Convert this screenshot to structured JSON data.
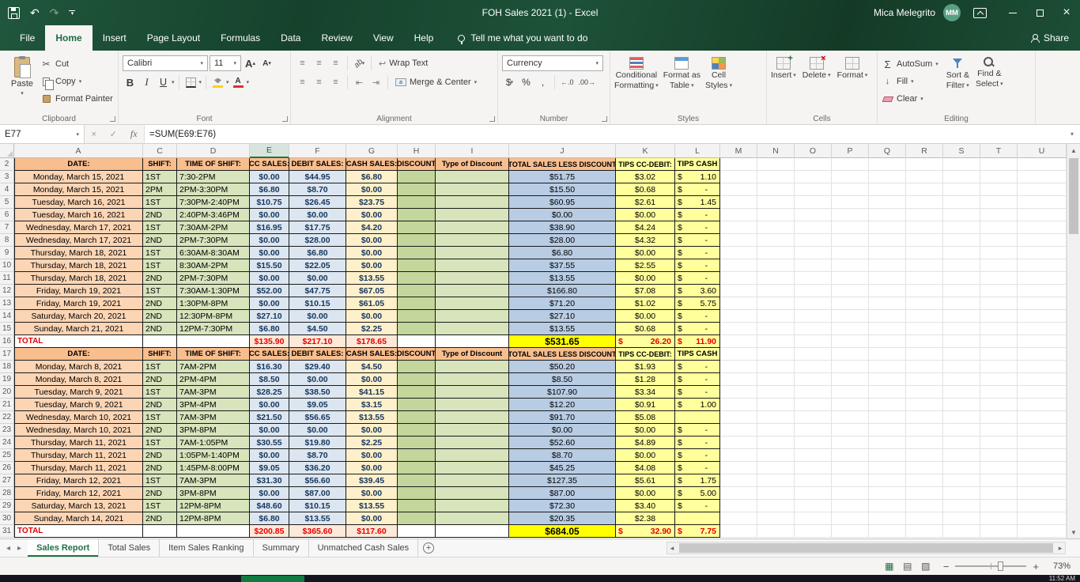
{
  "titlebar": {
    "title": "FOH Sales 2021 (1) - Excel",
    "user": "Mica Melegrito",
    "avatar_initials": "MM"
  },
  "ribbon_tabs": [
    "File",
    "Home",
    "Insert",
    "Page Layout",
    "Formulas",
    "Data",
    "Review",
    "View",
    "Help"
  ],
  "active_tab": "Home",
  "tell_me": "Tell me what you want to do",
  "share_label": "Share",
  "icons": {
    "undo": "↶",
    "redo": "↷",
    "dropdown": "▾",
    "up_small": "▴",
    "cut": "✂",
    "autosum": "Σ",
    "formula": "fx",
    "cancel": "×",
    "confirm": "✓",
    "align": "≡",
    "orientation": "ab",
    "wrap": "↩",
    "indent_left": "⇤",
    "indent_right": "⇥",
    "currency_symbol": "$",
    "percent": "%",
    "comma": ",",
    "increase_decimal": "←.0",
    "decrease_decimal": ".00→",
    "fill_down": "↓",
    "bold": "B",
    "italic": "I",
    "underline": "U",
    "merge_letter": "a",
    "nav_left": "◂",
    "nav_right": "▸",
    "scroll_up": "▲",
    "scroll_down": "▼",
    "view_normal": "▦",
    "view_page_layout": "▤",
    "view_page_break": "▨",
    "zoom_out": "−",
    "zoom_in": "+",
    "new_sheet": "+",
    "minimize": "—",
    "close": "×"
  },
  "ribbon": {
    "clipboard": {
      "label": "Clipboard",
      "paste": "Paste",
      "cut": "Cut",
      "copy": "Copy",
      "format_painter": "Format Painter"
    },
    "font": {
      "label": "Font",
      "font_name": "Calibri",
      "font_size": "11"
    },
    "alignment": {
      "label": "Alignment",
      "wrap_text": "Wrap Text",
      "merge_center": "Merge & Center"
    },
    "number": {
      "label": "Number",
      "format": "Currency"
    },
    "styles": {
      "label": "Styles",
      "conditional_1": "Conditional",
      "conditional_2": "Formatting",
      "format_table_1": "Format as",
      "format_table_2": "Table",
      "cell_styles_1": "Cell",
      "cell_styles_2": "Styles"
    },
    "cells": {
      "label": "Cells",
      "insert": "Insert",
      "delete": "Delete",
      "format": "Format"
    },
    "editing": {
      "label": "Editing",
      "autosum": "AutoSum",
      "fill": "Fill",
      "clear": "Clear",
      "sort_1": "Sort &",
      "sort_2": "Filter",
      "find_1": "Find &",
      "find_2": "Select"
    }
  },
  "formula_bar": {
    "name_box": "E77",
    "formula": "=SUM(E69:E76)"
  },
  "spreadsheet": {
    "columns": [
      "A",
      "C",
      "D",
      "E",
      "F",
      "G",
      "H",
      "I",
      "J",
      "K",
      "L",
      "M",
      "N",
      "O",
      "P",
      "Q",
      "R",
      "S",
      "T",
      "U"
    ],
    "data_columns": [
      "A",
      "C",
      "D",
      "E",
      "F",
      "G",
      "H",
      "I",
      "J",
      "K",
      "L"
    ],
    "empty_columns": [
      "M",
      "N",
      "O",
      "P",
      "Q",
      "R",
      "S",
      "T",
      "U"
    ],
    "selected_column": "E",
    "rows": [
      {
        "n": 2,
        "type": "head",
        "cells": [
          "DATE:",
          "SHIFT:",
          "TIME OF SHIFT:",
          "CC SALES:",
          "DEBIT SALES:",
          "CASH SALES:",
          "DISCOUNT",
          "Type of Discount",
          "TOTAL SALES LESS DISCOUNT",
          "TIPS CC-DEBIT:",
          "TIPS CASH"
        ]
      },
      {
        "n": 3,
        "type": "data",
        "cells": [
          "Monday, March 15, 2021",
          "1ST",
          "7:30-2PM",
          "$0.00",
          "$44.95",
          "$6.80",
          "",
          "",
          "$51.75",
          "$3.02",
          {
            "d": "$",
            "acc": "1.10"
          }
        ]
      },
      {
        "n": 4,
        "type": "data",
        "cells": [
          "Monday, March 15, 2021",
          "2PM",
          "2PM-3:30PM",
          "$6.80",
          "$8.70",
          "$0.00",
          "",
          "",
          "$15.50",
          "$0.68",
          {
            "d": "$",
            "acc": "-"
          }
        ]
      },
      {
        "n": 5,
        "type": "data",
        "cells": [
          "Tuesday, March 16, 2021",
          "1ST",
          "7:30PM-2:40PM",
          "$10.75",
          "$26.45",
          "$23.75",
          "",
          "",
          "$60.95",
          "$2.61",
          {
            "d": "$",
            "acc": "1.45"
          }
        ]
      },
      {
        "n": 6,
        "type": "data",
        "cells": [
          "Tuesday, March 16, 2021",
          "2ND",
          "2:40PM-3:46PM",
          "$0.00",
          "$0.00",
          "$0.00",
          "",
          "",
          "$0.00",
          "$0.00",
          {
            "d": "$",
            "acc": "-"
          }
        ]
      },
      {
        "n": 7,
        "type": "data",
        "cells": [
          "Wednesday, March 17, 2021",
          "1ST",
          "7:30AM-2PM",
          "$16.95",
          "$17.75",
          "$4.20",
          "",
          "",
          "$38.90",
          "$4.24",
          {
            "d": "$",
            "acc": "-"
          }
        ]
      },
      {
        "n": 8,
        "type": "data",
        "cells": [
          "Wednesday, March 17, 2021",
          "2ND",
          "2PM-7:30PM",
          "$0.00",
          "$28.00",
          "$0.00",
          "",
          "",
          "$28.00",
          "$4.32",
          {
            "d": "$",
            "acc": "-"
          }
        ]
      },
      {
        "n": 9,
        "type": "data",
        "cells": [
          "Thursday, March 18, 2021",
          "1ST",
          "6:30AM-8:30AM",
          "$0.00",
          "$6.80",
          "$0.00",
          "",
          "",
          "$6.80",
          "$0.00",
          {
            "d": "$",
            "acc": "-"
          }
        ]
      },
      {
        "n": 10,
        "type": "data",
        "cells": [
          "Thursday, March 18, 2021",
          "1ST",
          "8:30AM-2PM",
          "$15.50",
          "$22.05",
          "$0.00",
          "",
          "",
          "$37.55",
          "$2.55",
          {
            "d": "$",
            "acc": "-"
          }
        ]
      },
      {
        "n": 11,
        "type": "data",
        "cells": [
          "Thursday, March 18, 2021",
          "2ND",
          "2PM-7:30PM",
          "$0.00",
          "$0.00",
          "$13.55",
          "",
          "",
          "$13.55",
          "$0.00",
          {
            "d": "$",
            "acc": "-"
          }
        ]
      },
      {
        "n": 12,
        "type": "data",
        "cells": [
          "Friday, March 19, 2021",
          "1ST",
          "7:30AM-1:30PM",
          "$52.00",
          "$47.75",
          "$67.05",
          "",
          "",
          "$166.80",
          "$7.08",
          {
            "d": "$",
            "acc": "3.60"
          }
        ]
      },
      {
        "n": 13,
        "type": "data",
        "cells": [
          "Friday, March 19, 2021",
          "2ND",
          "1:30PM-8PM",
          "$0.00",
          "$10.15",
          "$61.05",
          "",
          "",
          "$71.20",
          "$1.02",
          {
            "d": "$",
            "acc": "5.75"
          }
        ]
      },
      {
        "n": 14,
        "type": "data",
        "cells": [
          "Saturday, March 20, 2021",
          "2ND",
          "12:30PM-8PM",
          "$27.10",
          "$0.00",
          "$0.00",
          "",
          "",
          "$27.10",
          "$0.00",
          {
            "d": "$",
            "acc": "-"
          }
        ]
      },
      {
        "n": 15,
        "type": "data",
        "cells": [
          "Sunday, March 21, 2021",
          "2ND",
          "12PM-7:30PM",
          "$6.80",
          "$4.50",
          "$2.25",
          "",
          "",
          "$13.55",
          "$0.68",
          {
            "d": "$",
            "acc": "-"
          }
        ]
      },
      {
        "n": 16,
        "type": "total",
        "cells": [
          "TOTAL",
          "",
          "",
          "$135.90",
          "$217.10",
          "$178.65",
          "",
          "",
          "$531.65",
          {
            "d": "$",
            "acc": "26.20"
          },
          {
            "d": "$",
            "acc": "11.90"
          }
        ]
      },
      {
        "n": 17,
        "type": "head",
        "cells": [
          "DATE:",
          "SHIFT:",
          "TIME OF SHIFT:",
          "CC SALES:",
          "DEBIT SALES:",
          "CASH SALES:",
          "DISCOUNT",
          "Type of Discount",
          "TOTAL SALES LESS DISCOUNT",
          "TIPS CC-DEBIT:",
          "TIPS CASH"
        ]
      },
      {
        "n": 18,
        "type": "data",
        "cells": [
          "Monday, March 8, 2021",
          "1ST",
          "7AM-2PM",
          "$16.30",
          "$29.40",
          "$4.50",
          "",
          "",
          "$50.20",
          "$1.93",
          {
            "d": "$",
            "acc": "-"
          }
        ]
      },
      {
        "n": 19,
        "type": "data",
        "cells": [
          "Monday, March 8, 2021",
          "2ND",
          "2PM-4PM",
          "$8.50",
          "$0.00",
          "$0.00",
          "",
          "",
          "$8.50",
          "$1.28",
          {
            "d": "$",
            "acc": "-"
          }
        ]
      },
      {
        "n": 20,
        "type": "data",
        "cells": [
          "Tuesday, March 9, 2021",
          "1ST",
          "7AM-3PM",
          "$28.25",
          "$38.50",
          "$41.15",
          "",
          "",
          "$107.90",
          "$3.34",
          {
            "d": "$",
            "acc": "-"
          }
        ]
      },
      {
        "n": 21,
        "type": "data",
        "cells": [
          "Tuesday, March 9, 2021",
          "2ND",
          "3PM-4PM",
          "$0.00",
          "$9.05",
          "$3.15",
          "",
          "",
          "$12.20",
          "$0.91",
          {
            "d": "$",
            "acc": "1.00"
          }
        ]
      },
      {
        "n": 22,
        "type": "data",
        "cells": [
          "Wednesday, March 10, 2021",
          "1ST",
          "7AM-3PM",
          "$21.50",
          "$56.65",
          "$13.55",
          "",
          "",
          "$91.70",
          "$5.08",
          ""
        ]
      },
      {
        "n": 23,
        "type": "data",
        "cells": [
          "Wednesday, March 10, 2021",
          "2ND",
          "3PM-8PM",
          "$0.00",
          "$0.00",
          "$0.00",
          "",
          "",
          "$0.00",
          "$0.00",
          {
            "d": "$",
            "acc": "-"
          }
        ]
      },
      {
        "n": 24,
        "type": "data",
        "cells": [
          "Thursday, March 11, 2021",
          "1ST",
          "7AM-1:05PM",
          "$30.55",
          "$19.80",
          "$2.25",
          "",
          "",
          "$52.60",
          "$4.89",
          {
            "d": "$",
            "acc": "-"
          }
        ]
      },
      {
        "n": 25,
        "type": "data",
        "cells": [
          "Thursday, March 11, 2021",
          "2ND",
          "1:05PM-1:40PM",
          "$0.00",
          "$8.70",
          "$0.00",
          "",
          "",
          "$8.70",
          "$0.00",
          {
            "d": "$",
            "acc": "-"
          }
        ]
      },
      {
        "n": 26,
        "type": "data",
        "cells": [
          "Thursday, March 11, 2021",
          "2ND",
          "1:45PM-8:00PM",
          "$9.05",
          "$36.20",
          "$0.00",
          "",
          "",
          "$45.25",
          "$4.08",
          {
            "d": "$",
            "acc": "-"
          }
        ]
      },
      {
        "n": 27,
        "type": "data",
        "cells": [
          "Friday, March 12, 2021",
          "1ST",
          "7AM-3PM",
          "$31.30",
          "$56.60",
          "$39.45",
          "",
          "",
          "$127.35",
          "$5.61",
          {
            "d": "$",
            "acc": "1.75"
          }
        ]
      },
      {
        "n": 28,
        "type": "data",
        "cells": [
          "Friday, March 12, 2021",
          "2ND",
          "3PM-8PM",
          "$0.00",
          "$87.00",
          "$0.00",
          "",
          "",
          "$87.00",
          "$0.00",
          {
            "d": "$",
            "acc": "5.00"
          }
        ]
      },
      {
        "n": 29,
        "type": "data",
        "cells": [
          "Saturday, March 13, 2021",
          "1ST",
          "12PM-8PM",
          "$48.60",
          "$10.15",
          "$13.55",
          "",
          "",
          "$72.30",
          "$3.40",
          {
            "d": "$",
            "acc": "-"
          }
        ]
      },
      {
        "n": 30,
        "type": "data",
        "cells": [
          "Sunday, March 14, 2021",
          "2ND",
          "12PM-8PM",
          "$6.80",
          "$13.55",
          "$0.00",
          "",
          "",
          "$20.35",
          "$2.38",
          ""
        ]
      },
      {
        "n": 31,
        "type": "total",
        "cells": [
          "TOTAL",
          "",
          "",
          "$200.85",
          "$365.60",
          "$117.60",
          "",
          "",
          "$684.05",
          {
            "d": "$",
            "acc": "32.90"
          },
          {
            "d": "$",
            "acc": "7.75"
          }
        ]
      }
    ]
  },
  "sheet_tabs": {
    "tabs": [
      "Sales Report",
      "Total Sales",
      "Item Sales Ranking",
      "Summary",
      "Unmatched Cash Sales"
    ],
    "active": "Sales Report"
  },
  "status_bar": {
    "zoom": "73%"
  },
  "taskbar": {
    "time": "11:52 AM"
  }
}
